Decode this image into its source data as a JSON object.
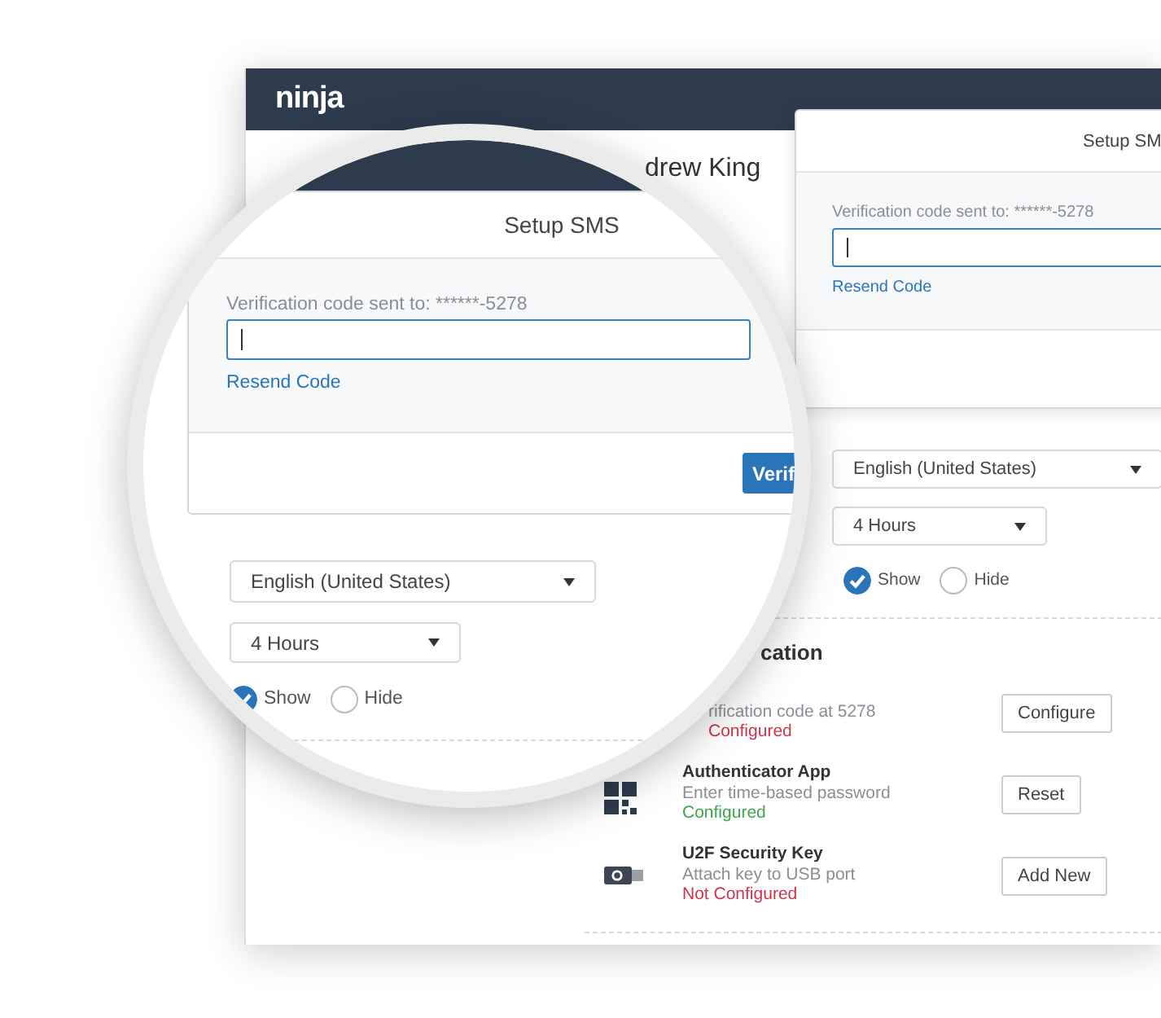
{
  "app": {
    "logo": "ninja",
    "user_name": "drew King"
  },
  "modal": {
    "title": "Setup SM",
    "code_label": "Verification code sent to: ******-5278",
    "resend_link": "Resend Code"
  },
  "settings": {
    "language": "English (United States)",
    "timeout": "4 Hours",
    "visibility": [
      {
        "label": "Show",
        "selected": true
      },
      {
        "label": "Hide",
        "selected": false
      }
    ]
  },
  "auth": {
    "heading": "cation",
    "methods": [
      {
        "kind": "sms",
        "description": "rification code at 5278",
        "status": "Configured",
        "configured": false,
        "action": "Configure"
      },
      {
        "kind": "app",
        "name": "Authenticator App",
        "description": "Enter time-based password",
        "status": "Configured",
        "configured": true,
        "action": "Reset"
      },
      {
        "kind": "key",
        "name": "U2F Security Key",
        "description": "Attach key to USB port",
        "status": "Not Configured",
        "configured": false,
        "action": "Add New"
      }
    ]
  },
  "magnifier": {
    "modal": {
      "title": "Setup SMS",
      "code_label": "Verification code sent to: ******-5278",
      "resend_link": "Resend Code",
      "verify_button": "Verif"
    },
    "settings": {
      "language": "English (United States)",
      "timeout": "4 Hours",
      "visibility": [
        {
          "label": "Show",
          "selected": true
        },
        {
          "label": "Hide",
          "selected": false
        }
      ]
    }
  }
}
